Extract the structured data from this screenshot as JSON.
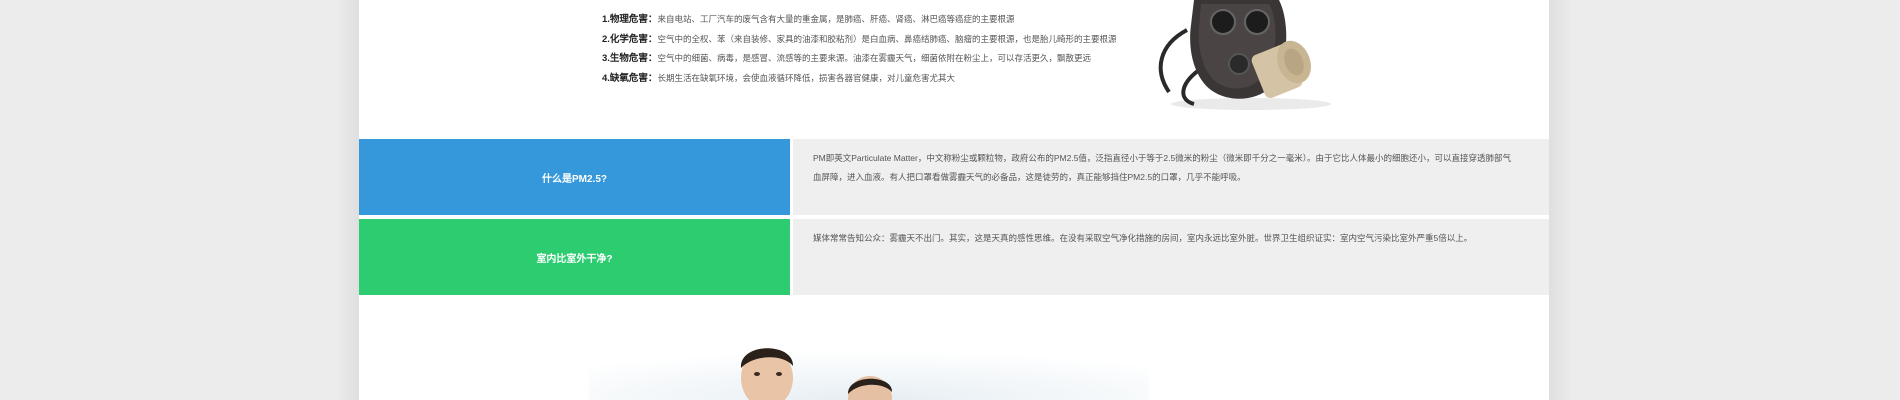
{
  "hazards": [
    {
      "label": "1.物理危害：",
      "text": "来自电站、工厂汽车的废气含有大量的重金属，是肺癌、肝癌、肾癌、淋巴癌等癌症的主要根源"
    },
    {
      "label": "2.化学危害：",
      "text": "空气中的全权、苯（来自装修、家具的油漆和胶粘剂）是白血病、鼻癌结肺癌、脑瘤的主要根源，也是胎儿畸形的主要根源"
    },
    {
      "label": "3.生物危害：",
      "text": "空气中的细菌、病毒，是感冒、流感等的主要来源。油漆在雾霾天气，细菌依附在粉尘上，可以存活更久，飘散更远"
    },
    {
      "label": "4.缺氧危害：",
      "text": "长期生活在缺氧环境，会使血液循环降低，损害各器官健康，对儿童危害尤其大"
    }
  ],
  "mask_icon": "gas-mask",
  "info_rows": {
    "pm": {
      "label": "什么是PM2.5?",
      "text": "PM即英文Particulate        Matter，中文称粉尘或颗粒物，政府公布的PM2.5值，泛指直径小于等于2.5微米的粉尘（微米即千分之一毫米）。由于它比人体最小的细胞还小，可以直接穿透肺部气血屏障，进入血液。有人把口罩看做雾霾天气的必备品，这是徒劳的，真正能够挡住PM2.5的口罩，几乎不能呼吸。",
      "color": "#3598db"
    },
    "indoor": {
      "label": "室内比室外干净?",
      "text": "媒体常常告知公众：雾霾天不出门。其实，这是天真的感性思维。在没有采取空气净化措施的房间，室内永远比室外脏。世界卫生组织证实：室内空气污染比室外严重5倍以上。",
      "color": "#2ecc71"
    }
  },
  "photo_subject": "children-photo"
}
